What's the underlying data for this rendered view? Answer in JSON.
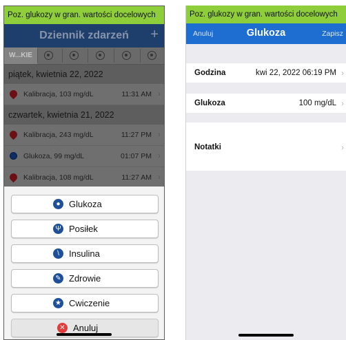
{
  "left": {
    "banner": "Poz. glukozy w gran. wartości docelowych",
    "nav": {
      "title": "Dziennik zdarzeń",
      "add_label": "+"
    },
    "filter": {
      "selected_label": "W...KIE",
      "icons": [
        "glucose-filter-icon",
        "meal-filter-icon",
        "insulin-filter-icon",
        "health-filter-icon",
        "exercise-filter-icon"
      ]
    },
    "sections": [
      {
        "header": "piątek, kwietnia 22, 2022",
        "rows": [
          {
            "icon": "calibration-drop-icon",
            "text": "Kalibracja, 103 mg/dL",
            "time": "11:31 AM"
          }
        ]
      },
      {
        "header": "czwartek, kwietnia 21, 2022",
        "rows": [
          {
            "icon": "calibration-drop-icon",
            "text": "Kalibracja, 243 mg/dL",
            "time": "11:27 PM"
          },
          {
            "icon": "glucose-icon",
            "text": "Glukoza, 99 mg/dL",
            "time": "01:07 PM"
          },
          {
            "icon": "calibration-drop-icon",
            "text": "Kalibracja, 108 mg/dL",
            "time": "11:27 AM"
          }
        ]
      }
    ],
    "action_sheet": {
      "buttons": [
        {
          "label": "Glukoza",
          "icon": "glucose-drop-icon"
        },
        {
          "label": "Posiłek",
          "icon": "meal-icon"
        },
        {
          "label": "Insulina",
          "icon": "syringe-icon"
        },
        {
          "label": "Zdrowie",
          "icon": "health-pencil-icon"
        },
        {
          "label": "Cwiczenie",
          "icon": "exercise-runner-icon"
        }
      ],
      "cancel_label": "Anuluj"
    }
  },
  "right": {
    "banner": "Poz. glukozy w gran. wartości docelowych",
    "nav": {
      "cancel_label": "Anuluj",
      "title": "Glukoza",
      "save_label": "Zapisz"
    },
    "fields": [
      {
        "label": "Godzina",
        "value": "kwi 22, 2022 06:19 PM"
      },
      {
        "label": "Glukoza",
        "value": "100 mg/dL"
      }
    ],
    "notes_label": "Notatki"
  },
  "colors": {
    "banner": "#8fce3b",
    "left_nav": "#1e3e6b",
    "right_nav": "#1e6dd1",
    "cancel_red": "#e33a3a"
  }
}
